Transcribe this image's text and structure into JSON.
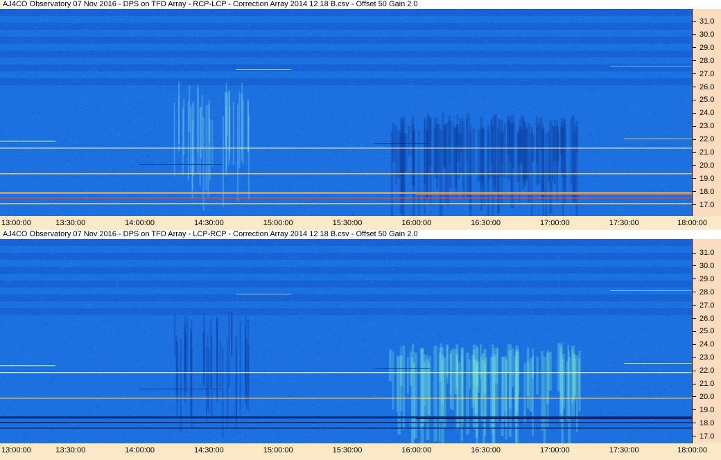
{
  "panels": [
    {
      "title": "AJ4CO Observatory 07 Nov 2016  -  DPS on TFD Array  -  RCP-LCP  -  Correction Array 2014 12 18 B.csv  -  Offset 50  Gain 2.0",
      "mode": "rcp-lcp"
    },
    {
      "title": "AJ4CO Observatory 07 Nov 2016  -  DPS on TFD Array  -  LCP-RCP  -  Correction Array 2014 12 18 B.csv  -  Offset 50  Gain 2.0",
      "mode": "lcp-rcp"
    }
  ],
  "y_ticks": [
    "31.0",
    "30.0",
    "29.0",
    "28.0",
    "27.0",
    "26.0",
    "25.0",
    "24.0",
    "23.0",
    "22.0",
    "21.0",
    "20.0",
    "19.0",
    "18.0",
    "17.0"
  ],
  "x_ticks": [
    "13:00:00",
    "13:30:00",
    "14:00:00",
    "14:30:00",
    "15:00:00",
    "15:30:00",
    "16:00:00",
    "16:30:00",
    "17:00:00",
    "17:30:00",
    "18:00:00"
  ],
  "colors": {
    "background_blue": "#1a6fe0",
    "axis_panel": "#fbdcbf",
    "page_background": "#fbe9c8"
  }
}
